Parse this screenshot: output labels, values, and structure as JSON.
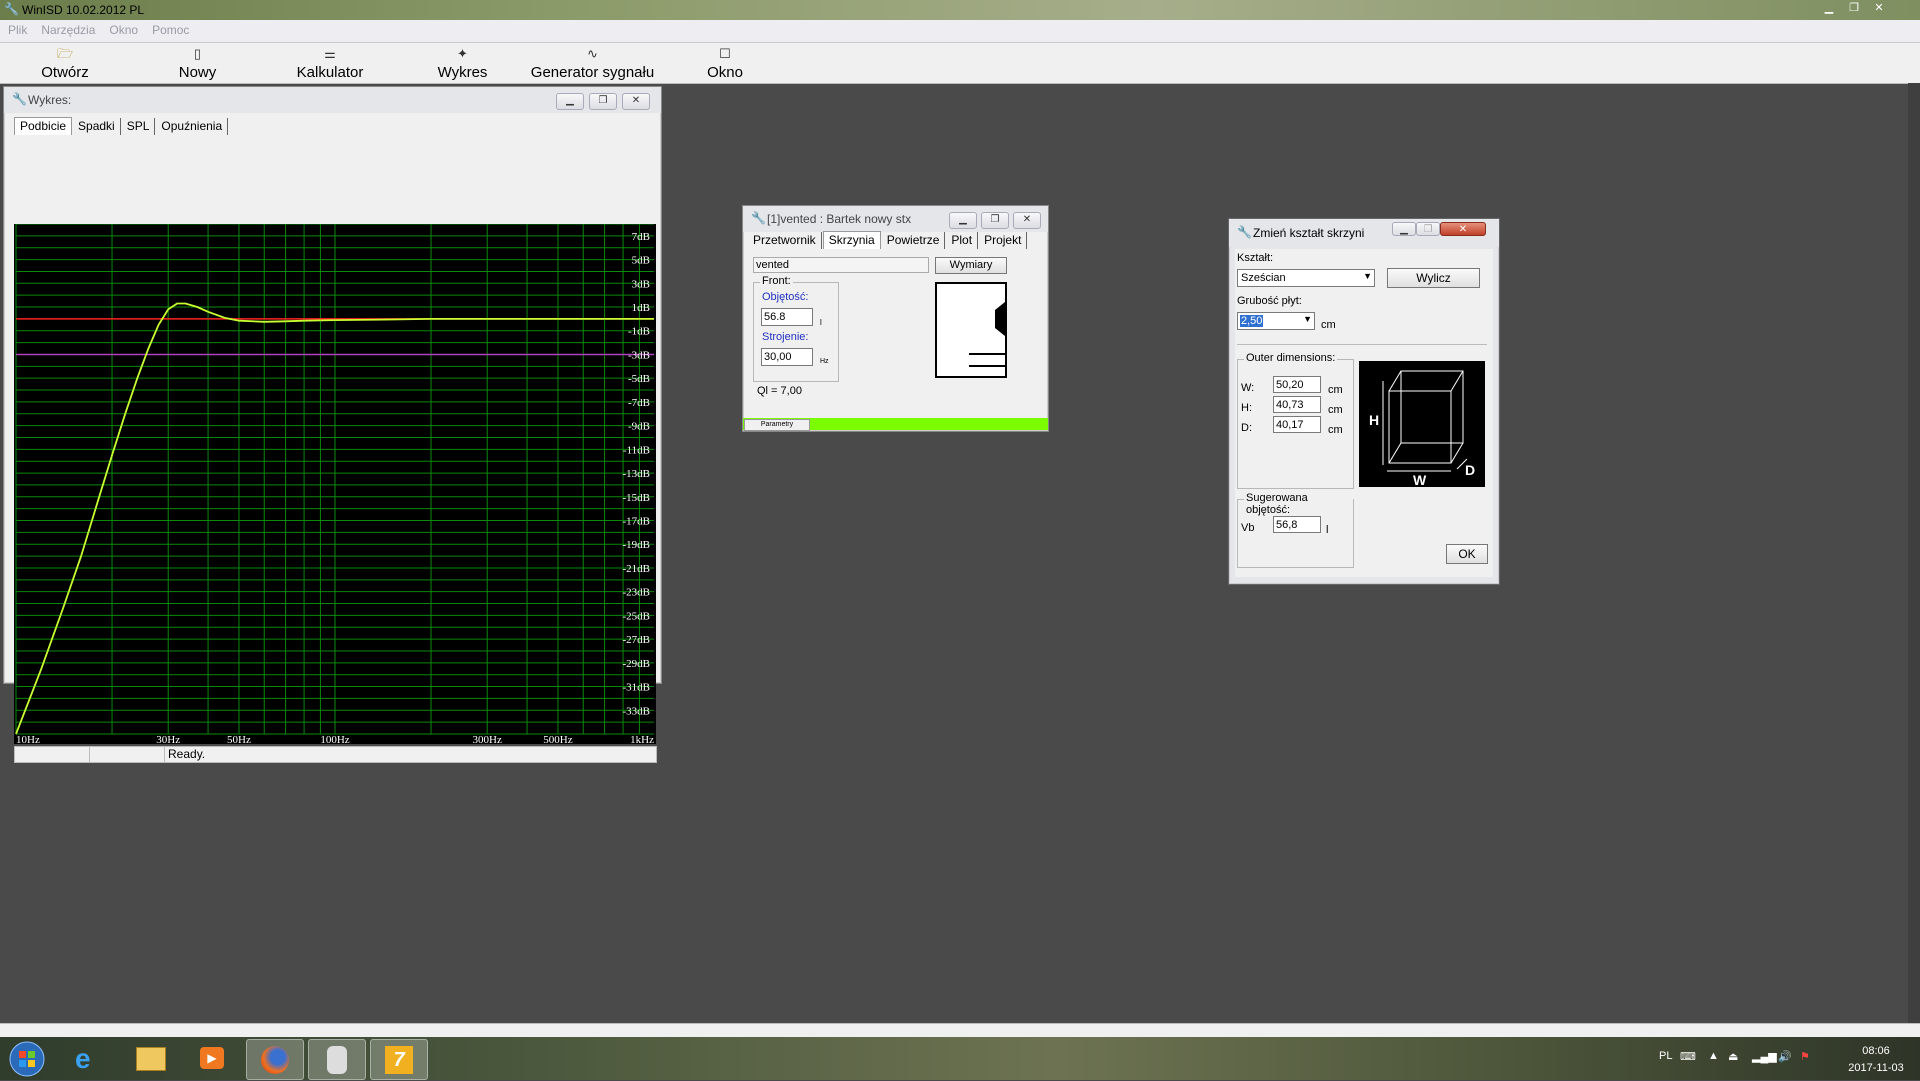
{
  "app": {
    "title": "WinISD 10.02.2012 PL",
    "menu": [
      "Plik",
      "Narzędzia",
      "Okno",
      "Pomoc"
    ]
  },
  "toolbar": [
    {
      "label": "Otwórz",
      "icon": "folder-icon"
    },
    {
      "label": "Nowy",
      "icon": "new-document-icon"
    },
    {
      "label": "Kalkulator",
      "icon": "calculator-icon"
    },
    {
      "label": "Wykres",
      "icon": "chart-icon"
    },
    {
      "label": "Generator sygnału",
      "icon": "signal-generator-icon"
    },
    {
      "label": "Okno",
      "icon": "window-icon"
    }
  ],
  "graph_window": {
    "title": "Wykres:",
    "tabs": [
      "Podbicie",
      "Spadki",
      "SPL",
      "Opuźnienia"
    ],
    "status": "Ready.",
    "chart_data": {
      "type": "line",
      "x_scale": "log",
      "xlim": [
        10,
        1000
      ],
      "ylim": [
        -35,
        8
      ],
      "x_ticks": [
        {
          "v": 10,
          "l": "10Hz"
        },
        {
          "v": 30,
          "l": "30Hz"
        },
        {
          "v": 50,
          "l": "50Hz"
        },
        {
          "v": 100,
          "l": "100Hz"
        },
        {
          "v": 300,
          "l": "300Hz"
        },
        {
          "v": 500,
          "l": "500Hz"
        },
        {
          "v": 1000,
          "l": "1kHz"
        }
      ],
      "y_ticks": [
        "7dB",
        "5dB",
        "3dB",
        "1dB",
        "-1dB",
        "-3dB",
        "-5dB",
        "-7dB",
        "-9dB",
        "-11dB",
        "-13dB",
        "-15dB",
        "-17dB",
        "-19dB",
        "-21dB",
        "-23dB",
        "-25dB",
        "-27dB",
        "-29dB",
        "-31dB",
        "-33dB"
      ],
      "grid": true,
      "reference_lines": [
        {
          "y": 0,
          "color": "#ff2020"
        },
        {
          "y": -3,
          "color": "#b040c0"
        }
      ],
      "series": [
        {
          "color": "#c8ff30",
          "x": [
            10,
            12,
            14,
            16,
            18,
            20,
            22,
            24,
            26,
            28,
            30,
            32,
            34,
            37,
            40,
            45,
            50,
            60,
            70,
            80,
            100,
            150,
            200,
            300,
            500,
            1000
          ],
          "y": [
            -35,
            -29.5,
            -24.5,
            -20,
            -15.5,
            -11.5,
            -8,
            -5,
            -2.5,
            -0.5,
            0.8,
            1.3,
            1.3,
            1.0,
            0.6,
            0.1,
            -0.15,
            -0.25,
            -0.2,
            -0.15,
            -0.1,
            -0.05,
            0,
            0,
            0,
            0
          ]
        }
      ]
    }
  },
  "vented_window": {
    "title": "[1]vented : Bartek nowy stx",
    "tabs": [
      "Przetwornik",
      "Skrzynia",
      "Powietrze",
      "Plot",
      "Projekt"
    ],
    "name_value": "vented",
    "dims_button": "Wymiary",
    "front_label": "Front:",
    "volume_label": "Objętość:",
    "volume_value": "56.8",
    "volume_unit": "l",
    "tuning_label": "Strojenie:",
    "tuning_value": "30,00",
    "tuning_unit": "Hz",
    "ql": "Ql = 7,00",
    "params_tab": "Parametry"
  },
  "shape_dialog": {
    "title": "Zmień kształt skrzyni",
    "shape_label": "Kształt:",
    "shape_value": "Sześcian",
    "calc_button": "Wylicz",
    "thickness_label": "Grubość płyt:",
    "thickness_value": "2,50",
    "thickness_unit": "cm",
    "outer_label": "Outer dimensions:",
    "w_label": "W:",
    "w_value": "50,20",
    "h_label": "H:",
    "h_value": "40,73",
    "d_label": "D:",
    "d_value": "40,17",
    "dim_unit": "cm",
    "suggested_label": "Sugerowana objętość:",
    "vb_label": "Vb",
    "vb_value": "56,8",
    "vb_unit": "l",
    "ok_button": "OK",
    "diagram_labels": {
      "h": "H",
      "w": "W",
      "d": "D"
    }
  },
  "taskbar": {
    "lang": "PL",
    "time": "08:06",
    "date": "2017-11-03"
  }
}
